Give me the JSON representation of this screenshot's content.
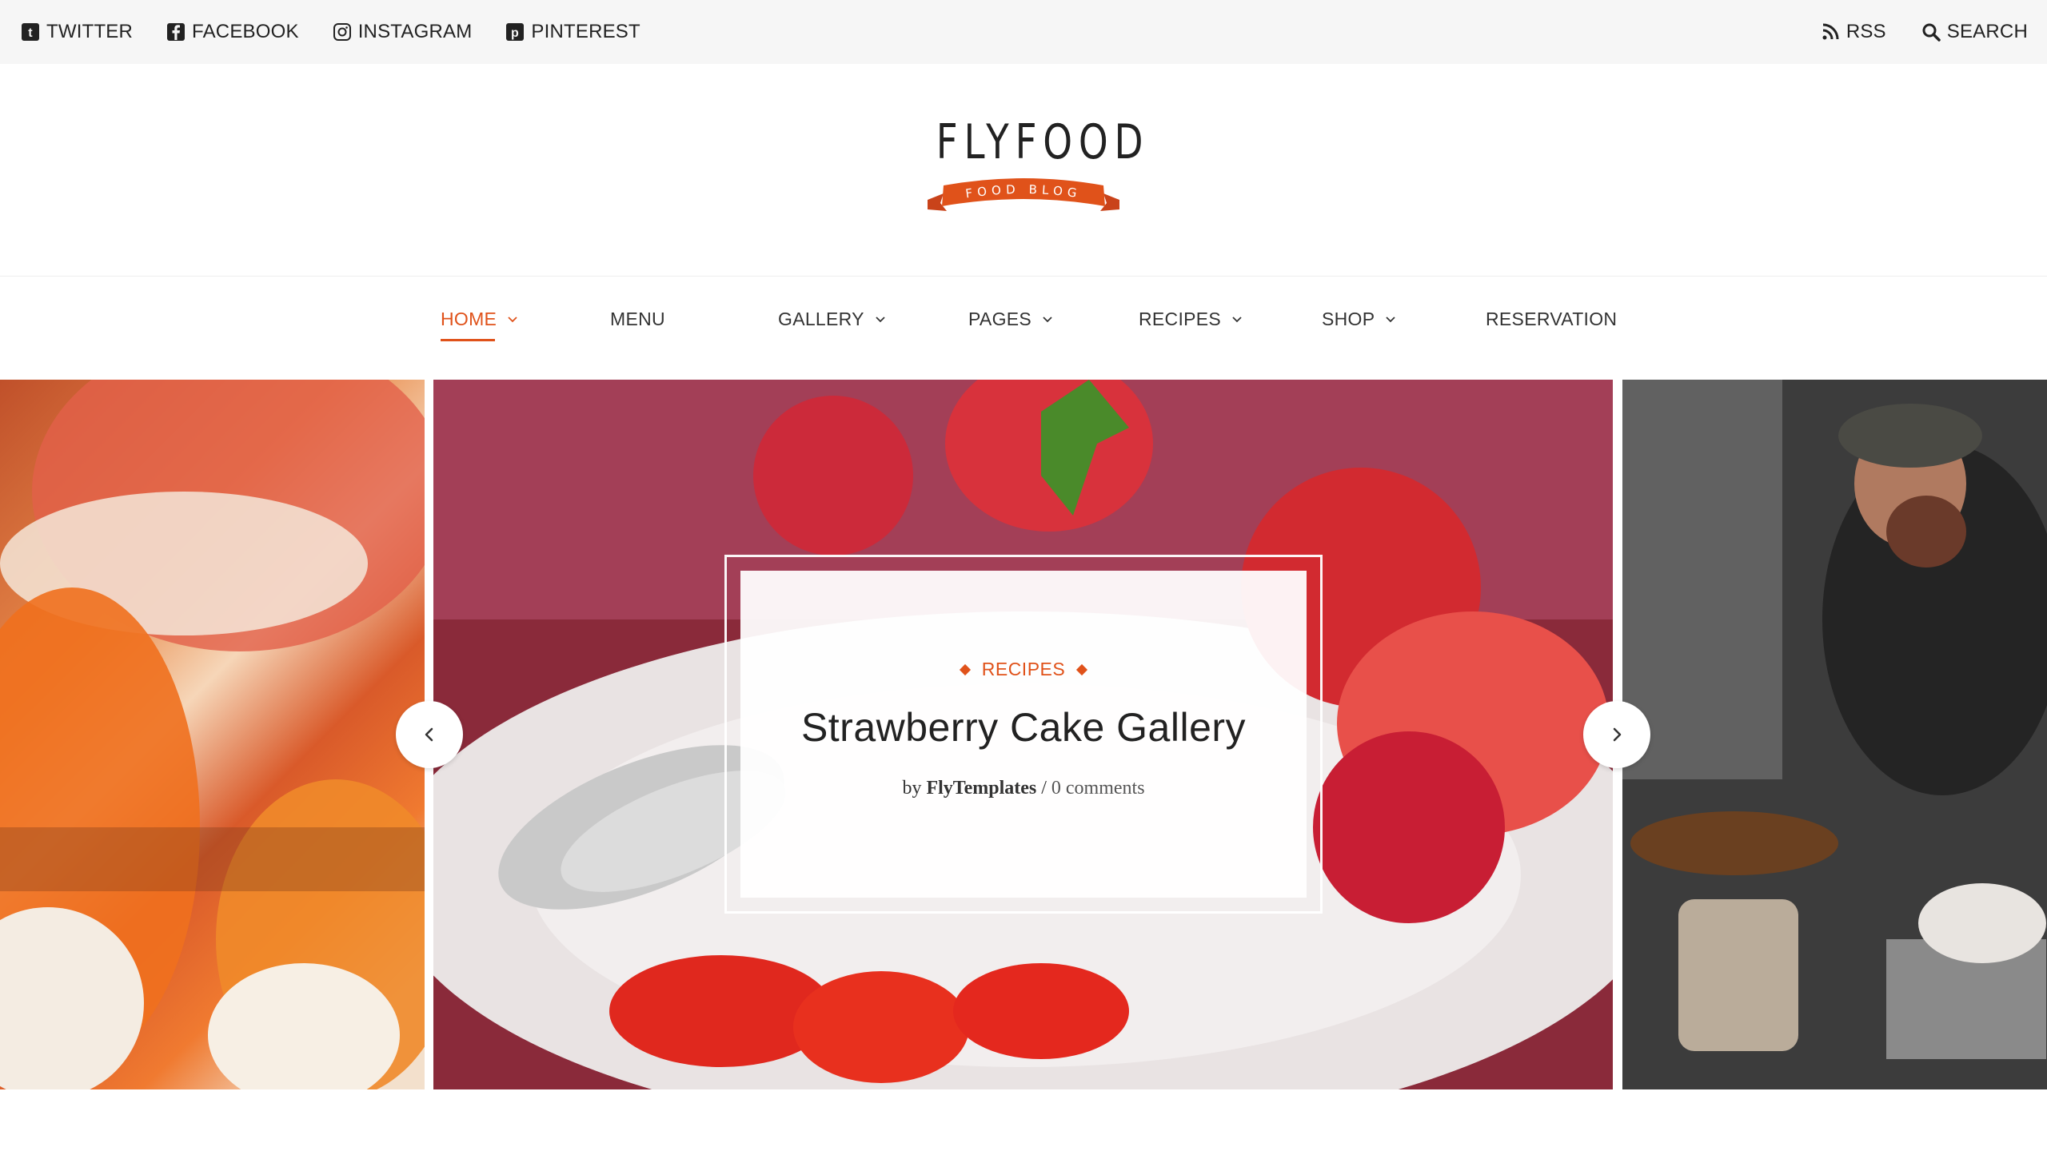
{
  "topbar": {
    "social": [
      {
        "label": "TWITTER",
        "icon": "tumblr-icon"
      },
      {
        "label": "FACEBOOK",
        "icon": "facebook-icon"
      },
      {
        "label": "INSTAGRAM",
        "icon": "instagram-icon"
      },
      {
        "label": "PINTEREST",
        "icon": "pinterest-icon"
      }
    ],
    "rss_label": "RSS",
    "search_label": "SEARCH"
  },
  "logo": {
    "name": "FLYFOOD",
    "ribbon": "FOOD BLOG",
    "accent": "#e0521a"
  },
  "nav": {
    "items": [
      {
        "label": "HOME",
        "active": true,
        "dropdown": true
      },
      {
        "label": "MENU",
        "active": false,
        "dropdown": false
      },
      {
        "label": "GALLERY",
        "active": false,
        "dropdown": true
      },
      {
        "label": "PAGES",
        "active": false,
        "dropdown": true
      },
      {
        "label": "RECIPES",
        "active": false,
        "dropdown": true
      },
      {
        "label": "SHOP",
        "active": false,
        "dropdown": true
      },
      {
        "label": "RESERVATION",
        "active": false,
        "dropdown": false
      }
    ]
  },
  "slider": {
    "category": "RECIPES",
    "title": "Strawberry Cake Gallery",
    "by_prefix": "by",
    "author": "FlyTemplates",
    "separator": "/",
    "comments": "0 comments"
  }
}
